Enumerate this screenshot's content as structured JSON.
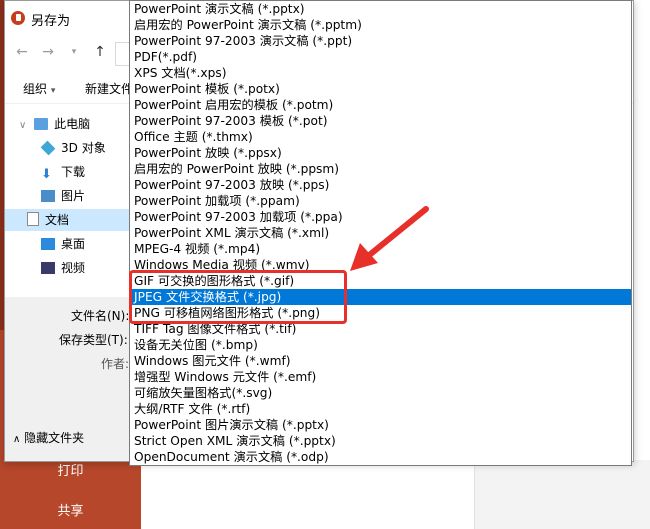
{
  "dialog": {
    "title": "另存为",
    "toolbar": {
      "organize": "组织",
      "organize_arrow": "▾",
      "new_folder": "新建文件"
    },
    "nav_items": [
      {
        "label": "此电脑",
        "icon": "computer-icon"
      },
      {
        "label": "3D 对象",
        "icon": "cube-3d-icon"
      },
      {
        "label": "下载",
        "icon": "download-icon"
      },
      {
        "label": "图片",
        "icon": "pictures-icon"
      },
      {
        "label": "文档",
        "icon": "document-icon"
      },
      {
        "label": "桌面",
        "icon": "desktop-icon"
      },
      {
        "label": "视频",
        "icon": "video-icon"
      }
    ],
    "filename_label": "文件名(N):",
    "savetype_label": "保存类型(T):",
    "author_label": "作者:",
    "hide_folders": "隐藏文件夹"
  },
  "backstage": {
    "print": "打印",
    "share": "共享"
  },
  "file_types": [
    "PowerPoint 演示文稿 (*.pptx)",
    "启用宏的 PowerPoint 演示文稿 (*.pptm)",
    "PowerPoint 97-2003 演示文稿 (*.ppt)",
    "PDF(*.pdf)",
    "XPS 文档(*.xps)",
    "PowerPoint 模板 (*.potx)",
    "PowerPoint 启用宏的模板 (*.potm)",
    "PowerPoint 97-2003 模板 (*.pot)",
    "Office 主题 (*.thmx)",
    "PowerPoint 放映 (*.ppsx)",
    "启用宏的 PowerPoint 放映 (*.ppsm)",
    "PowerPoint 97-2003 放映 (*.pps)",
    "PowerPoint 加载项 (*.ppam)",
    "PowerPoint 97-2003 加载项 (*.ppa)",
    "PowerPoint XML 演示文稿 (*.xml)",
    "MPEG-4 视频 (*.mp4)",
    "Windows Media 视频 (*.wmv)",
    "GIF 可交换的图形格式 (*.gif)",
    "JPEG 文件交换格式 (*.jpg)",
    "PNG 可移植网络图形格式 (*.png)",
    "TIFF Tag 图像文件格式 (*.tif)",
    "设备无关位图 (*.bmp)",
    "Windows 图元文件 (*.wmf)",
    "增强型 Windows 元文件 (*.emf)",
    "可缩放矢量图格式(*.svg)",
    "大纲/RTF 文件 (*.rtf)",
    "PowerPoint 图片演示文稿 (*.pptx)",
    "Strict Open XML 演示文稿 (*.pptx)",
    "OpenDocument 演示文稿 (*.odp)"
  ],
  "selected_index": 18,
  "colors": {
    "selection": "#0078d7",
    "highlight_box": "#e8302a",
    "powerpoint_brand": "#b7472a"
  }
}
